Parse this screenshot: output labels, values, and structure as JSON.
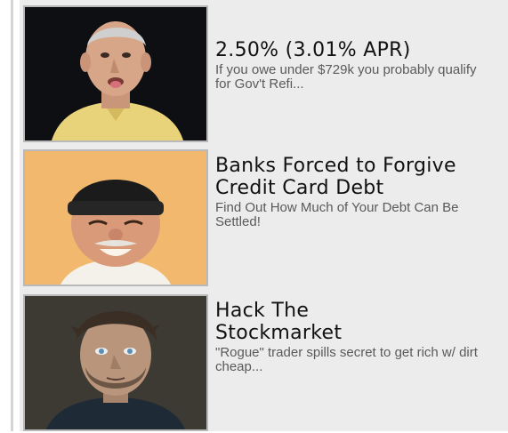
{
  "ads": [
    {
      "headline": "2.50% (3.01% APR)",
      "description": "If you owe under $729k you probably qualify for Gov't Refi...",
      "image": "elderly-man-yellow-shirt-photo"
    },
    {
      "headline": "Banks Forced to Forgive Credit Card Debt",
      "description": "Find Out How Much of Your Debt Can Be Settled!",
      "image": "smiling-man-black-beanie-photo"
    },
    {
      "headline": "Hack The Stockmarket",
      "description": "\"Rogue\" trader spills secret to get rich w/ dirt cheap...",
      "image": "young-man-portrait-photo"
    }
  ]
}
